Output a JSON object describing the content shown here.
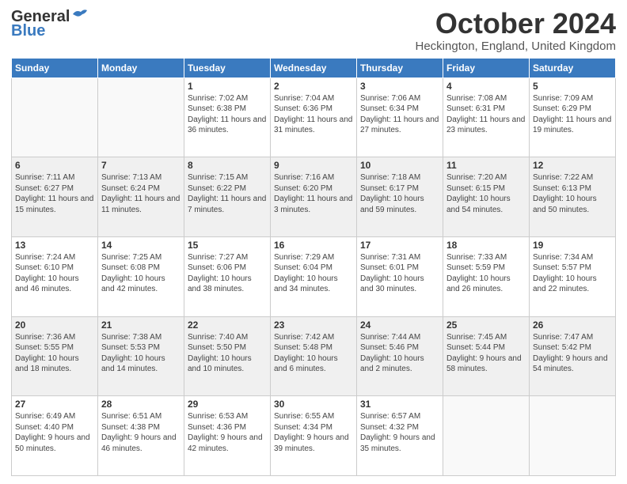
{
  "header": {
    "logo_general": "General",
    "logo_blue": "Blue",
    "month_title": "October 2024",
    "location": "Heckington, England, United Kingdom"
  },
  "days_of_week": [
    "Sunday",
    "Monday",
    "Tuesday",
    "Wednesday",
    "Thursday",
    "Friday",
    "Saturday"
  ],
  "weeks": [
    [
      {
        "day": "",
        "sunrise": "",
        "sunset": "",
        "daylight": ""
      },
      {
        "day": "",
        "sunrise": "",
        "sunset": "",
        "daylight": ""
      },
      {
        "day": "1",
        "sunrise": "Sunrise: 7:02 AM",
        "sunset": "Sunset: 6:38 PM",
        "daylight": "Daylight: 11 hours and 36 minutes."
      },
      {
        "day": "2",
        "sunrise": "Sunrise: 7:04 AM",
        "sunset": "Sunset: 6:36 PM",
        "daylight": "Daylight: 11 hours and 31 minutes."
      },
      {
        "day": "3",
        "sunrise": "Sunrise: 7:06 AM",
        "sunset": "Sunset: 6:34 PM",
        "daylight": "Daylight: 11 hours and 27 minutes."
      },
      {
        "day": "4",
        "sunrise": "Sunrise: 7:08 AM",
        "sunset": "Sunset: 6:31 PM",
        "daylight": "Daylight: 11 hours and 23 minutes."
      },
      {
        "day": "5",
        "sunrise": "Sunrise: 7:09 AM",
        "sunset": "Sunset: 6:29 PM",
        "daylight": "Daylight: 11 hours and 19 minutes."
      }
    ],
    [
      {
        "day": "6",
        "sunrise": "Sunrise: 7:11 AM",
        "sunset": "Sunset: 6:27 PM",
        "daylight": "Daylight: 11 hours and 15 minutes."
      },
      {
        "day": "7",
        "sunrise": "Sunrise: 7:13 AM",
        "sunset": "Sunset: 6:24 PM",
        "daylight": "Daylight: 11 hours and 11 minutes."
      },
      {
        "day": "8",
        "sunrise": "Sunrise: 7:15 AM",
        "sunset": "Sunset: 6:22 PM",
        "daylight": "Daylight: 11 hours and 7 minutes."
      },
      {
        "day": "9",
        "sunrise": "Sunrise: 7:16 AM",
        "sunset": "Sunset: 6:20 PM",
        "daylight": "Daylight: 11 hours and 3 minutes."
      },
      {
        "day": "10",
        "sunrise": "Sunrise: 7:18 AM",
        "sunset": "Sunset: 6:17 PM",
        "daylight": "Daylight: 10 hours and 59 minutes."
      },
      {
        "day": "11",
        "sunrise": "Sunrise: 7:20 AM",
        "sunset": "Sunset: 6:15 PM",
        "daylight": "Daylight: 10 hours and 54 minutes."
      },
      {
        "day": "12",
        "sunrise": "Sunrise: 7:22 AM",
        "sunset": "Sunset: 6:13 PM",
        "daylight": "Daylight: 10 hours and 50 minutes."
      }
    ],
    [
      {
        "day": "13",
        "sunrise": "Sunrise: 7:24 AM",
        "sunset": "Sunset: 6:10 PM",
        "daylight": "Daylight: 10 hours and 46 minutes."
      },
      {
        "day": "14",
        "sunrise": "Sunrise: 7:25 AM",
        "sunset": "Sunset: 6:08 PM",
        "daylight": "Daylight: 10 hours and 42 minutes."
      },
      {
        "day": "15",
        "sunrise": "Sunrise: 7:27 AM",
        "sunset": "Sunset: 6:06 PM",
        "daylight": "Daylight: 10 hours and 38 minutes."
      },
      {
        "day": "16",
        "sunrise": "Sunrise: 7:29 AM",
        "sunset": "Sunset: 6:04 PM",
        "daylight": "Daylight: 10 hours and 34 minutes."
      },
      {
        "day": "17",
        "sunrise": "Sunrise: 7:31 AM",
        "sunset": "Sunset: 6:01 PM",
        "daylight": "Daylight: 10 hours and 30 minutes."
      },
      {
        "day": "18",
        "sunrise": "Sunrise: 7:33 AM",
        "sunset": "Sunset: 5:59 PM",
        "daylight": "Daylight: 10 hours and 26 minutes."
      },
      {
        "day": "19",
        "sunrise": "Sunrise: 7:34 AM",
        "sunset": "Sunset: 5:57 PM",
        "daylight": "Daylight: 10 hours and 22 minutes."
      }
    ],
    [
      {
        "day": "20",
        "sunrise": "Sunrise: 7:36 AM",
        "sunset": "Sunset: 5:55 PM",
        "daylight": "Daylight: 10 hours and 18 minutes."
      },
      {
        "day": "21",
        "sunrise": "Sunrise: 7:38 AM",
        "sunset": "Sunset: 5:53 PM",
        "daylight": "Daylight: 10 hours and 14 minutes."
      },
      {
        "day": "22",
        "sunrise": "Sunrise: 7:40 AM",
        "sunset": "Sunset: 5:50 PM",
        "daylight": "Daylight: 10 hours and 10 minutes."
      },
      {
        "day": "23",
        "sunrise": "Sunrise: 7:42 AM",
        "sunset": "Sunset: 5:48 PM",
        "daylight": "Daylight: 10 hours and 6 minutes."
      },
      {
        "day": "24",
        "sunrise": "Sunrise: 7:44 AM",
        "sunset": "Sunset: 5:46 PM",
        "daylight": "Daylight: 10 hours and 2 minutes."
      },
      {
        "day": "25",
        "sunrise": "Sunrise: 7:45 AM",
        "sunset": "Sunset: 5:44 PM",
        "daylight": "Daylight: 9 hours and 58 minutes."
      },
      {
        "day": "26",
        "sunrise": "Sunrise: 7:47 AM",
        "sunset": "Sunset: 5:42 PM",
        "daylight": "Daylight: 9 hours and 54 minutes."
      }
    ],
    [
      {
        "day": "27",
        "sunrise": "Sunrise: 6:49 AM",
        "sunset": "Sunset: 4:40 PM",
        "daylight": "Daylight: 9 hours and 50 minutes."
      },
      {
        "day": "28",
        "sunrise": "Sunrise: 6:51 AM",
        "sunset": "Sunset: 4:38 PM",
        "daylight": "Daylight: 9 hours and 46 minutes."
      },
      {
        "day": "29",
        "sunrise": "Sunrise: 6:53 AM",
        "sunset": "Sunset: 4:36 PM",
        "daylight": "Daylight: 9 hours and 42 minutes."
      },
      {
        "day": "30",
        "sunrise": "Sunrise: 6:55 AM",
        "sunset": "Sunset: 4:34 PM",
        "daylight": "Daylight: 9 hours and 39 minutes."
      },
      {
        "day": "31",
        "sunrise": "Sunrise: 6:57 AM",
        "sunset": "Sunset: 4:32 PM",
        "daylight": "Daylight: 9 hours and 35 minutes."
      },
      {
        "day": "",
        "sunrise": "",
        "sunset": "",
        "daylight": ""
      },
      {
        "day": "",
        "sunrise": "",
        "sunset": "",
        "daylight": ""
      }
    ]
  ]
}
